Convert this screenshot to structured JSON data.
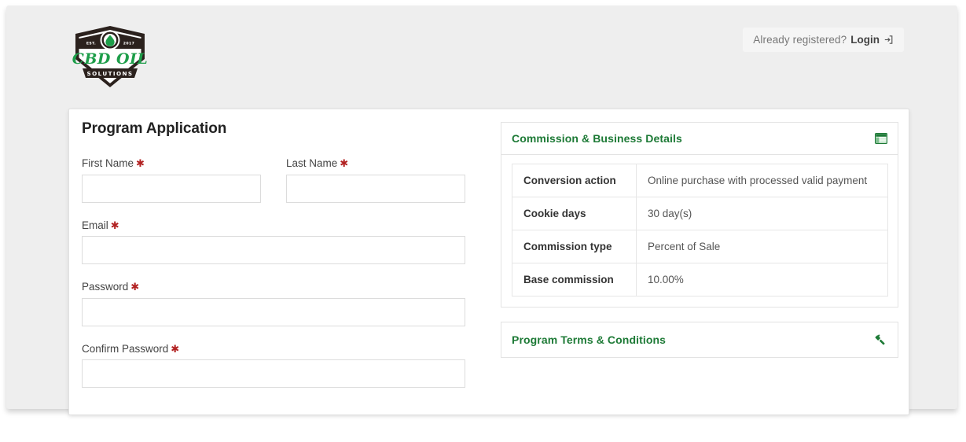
{
  "header": {
    "logo": {
      "name": "cbd-oil-solutions-logo",
      "brand_line": "CBD OIL",
      "sub_line": "SOLUTIONS",
      "left_banner": "EST.",
      "right_banner": "2017",
      "dark_color": "#2b211d",
      "green_color": "#1e9e4a"
    },
    "login": {
      "prompt": "Already registered?",
      "link_label": "Login",
      "icon": "sign-in-icon"
    }
  },
  "form": {
    "title": "Program Application",
    "required_marker": "✱",
    "fields": [
      {
        "label": "First Name",
        "required": true,
        "value": "",
        "placeholder": ""
      },
      {
        "label": "Last Name",
        "required": true,
        "value": "",
        "placeholder": ""
      },
      {
        "label": "Email",
        "required": true,
        "value": "",
        "placeholder": ""
      },
      {
        "label": "Password",
        "required": true,
        "value": "",
        "placeholder": ""
      },
      {
        "label": "Confirm Password",
        "required": true,
        "value": "",
        "placeholder": ""
      }
    ]
  },
  "details_panel": {
    "title": "Commission & Business Details",
    "icon": "table-icon",
    "accent_color": "#1d7a36",
    "rows": [
      {
        "key": "Conversion action",
        "value": "Online purchase with processed valid payment"
      },
      {
        "key": "Cookie days",
        "value": "30 day(s)"
      },
      {
        "key": "Commission type",
        "value": "Percent of Sale"
      },
      {
        "key": "Base commission",
        "value": "10.00%"
      }
    ]
  },
  "terms_panel": {
    "title": "Program Terms & Conditions",
    "icon": "gavel-icon"
  }
}
